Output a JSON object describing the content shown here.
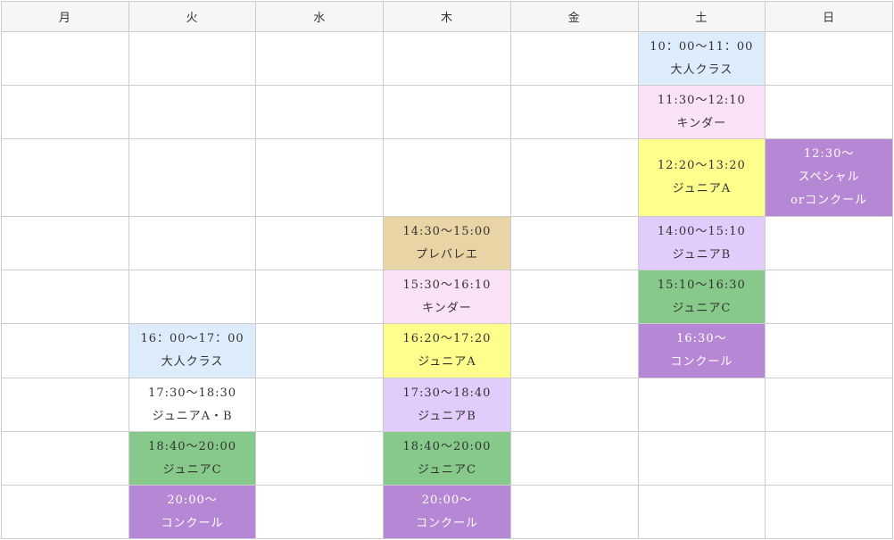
{
  "days": [
    "月",
    "火",
    "水",
    "木",
    "金",
    "土",
    "日"
  ],
  "colors": {
    "blue": "#dcecfb",
    "pink": "#f9e1f8",
    "yellow": "#fdfe8c",
    "tan": "#e9d4a5",
    "lavender": "#e2ccfb",
    "green": "#86c98a",
    "purple": "#b687d4"
  },
  "rows": [
    {
      "cells": [
        null,
        null,
        null,
        null,
        null,
        {
          "time": "10：00～11：00",
          "name": "大人クラス",
          "color": "blue"
        },
        null
      ]
    },
    {
      "cells": [
        null,
        null,
        null,
        null,
        null,
        {
          "time": "11:30～12:10",
          "name": "キンダー",
          "color": "pink"
        },
        null
      ]
    },
    {
      "cells": [
        null,
        null,
        null,
        null,
        null,
        {
          "time": "12:20～13:20",
          "name": "ジュニアA",
          "color": "yellow"
        },
        {
          "time": "12:30～",
          "name": "スペシャル",
          "extra": "orコンクール",
          "color": "purple"
        }
      ]
    },
    {
      "cells": [
        null,
        null,
        null,
        {
          "time": "14:30～15:00",
          "name": "プレバレエ",
          "color": "tan"
        },
        null,
        {
          "time": "14:00～15:10",
          "name": "ジュニアB",
          "color": "lavender"
        },
        null
      ]
    },
    {
      "cells": [
        null,
        null,
        null,
        {
          "time": "15:30～16:10",
          "name": "キンダー",
          "color": "pink"
        },
        null,
        {
          "time": "15:10～16:30",
          "name": "ジュニアC",
          "color": "green"
        },
        null
      ]
    },
    {
      "cells": [
        null,
        {
          "time": "16：00～17：00",
          "name": "大人クラス",
          "color": "blue"
        },
        null,
        {
          "time": "16:20～17:20",
          "name": "ジュニアA",
          "color": "yellow"
        },
        null,
        {
          "time": "16:30～",
          "name": "コンクール",
          "color": "purple"
        },
        null
      ]
    },
    {
      "cells": [
        null,
        {
          "time": "17:30～18:30",
          "name": "ジュニアA・B",
          "color": "white"
        },
        null,
        {
          "time": "17:30～18:40",
          "name": "ジュニアB",
          "color": "lavender"
        },
        null,
        null,
        null
      ]
    },
    {
      "cells": [
        null,
        {
          "time": "18:40～20:00",
          "name": "ジュニアC",
          "color": "green"
        },
        null,
        {
          "time": "18:40～20:00",
          "name": "ジュニアC",
          "color": "green"
        },
        null,
        null,
        null
      ]
    },
    {
      "cells": [
        null,
        {
          "time": "20:00～",
          "name": "コンクール",
          "color": "purple"
        },
        null,
        {
          "time": "20:00～",
          "name": "コンクール",
          "color": "purple"
        },
        null,
        null,
        null
      ]
    }
  ]
}
